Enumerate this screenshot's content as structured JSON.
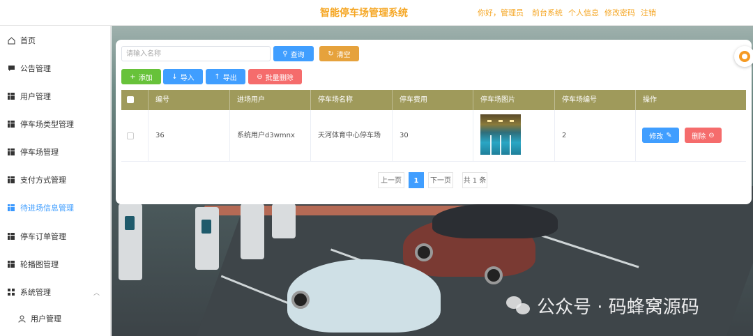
{
  "header": {
    "title": "智能停车场管理系统",
    "greeting": "你好，管理员",
    "links": [
      "前台系统",
      "个人信息",
      "修改密码",
      "注销"
    ]
  },
  "sidebar": {
    "items": [
      {
        "label": "首页",
        "icon": "home-icon"
      },
      {
        "label": "公告管理",
        "icon": "message-icon"
      },
      {
        "label": "用户管理",
        "icon": "grid-icon"
      },
      {
        "label": "停车场类型管理",
        "icon": "grid-icon"
      },
      {
        "label": "停车场管理",
        "icon": "grid-icon"
      },
      {
        "label": "支付方式管理",
        "icon": "grid-icon"
      },
      {
        "label": "待进场信息管理",
        "icon": "grid-icon",
        "active": true
      },
      {
        "label": "停车订单管理",
        "icon": "grid-icon"
      },
      {
        "label": "轮播图管理",
        "icon": "grid-icon"
      },
      {
        "label": "系统管理",
        "icon": "grid-icon",
        "expanded": true
      },
      {
        "label": "用户管理",
        "icon": "user-icon",
        "sub": true
      }
    ]
  },
  "toolbar": {
    "search_placeholder": "请输入名称",
    "search_label": "查询",
    "reset_label": "清空",
    "add_label": "添加",
    "import_label": "导入",
    "export_label": "导出",
    "batch_delete_label": "批量删除"
  },
  "table": {
    "columns": [
      "编号",
      "进场用户",
      "停车场名称",
      "停车费用",
      "停车场图片",
      "停车场编号",
      "操作"
    ],
    "rows": [
      {
        "id": "36",
        "user": "系统用户d3wmnx",
        "lot_name": "天河体育中心停车场",
        "fee": "30",
        "lot_no": "2",
        "edit_label": "修改",
        "delete_label": "删除"
      }
    ]
  },
  "pagination": {
    "prev": "上一页",
    "current": "1",
    "next": "下一页",
    "total": "共 1 条"
  },
  "watermark": "公众号 · 码蜂窝源码",
  "colors": {
    "accent": "#f5a623",
    "primary": "#409eff",
    "table_header": "#9f9a5b",
    "add": "#67c23a",
    "reset": "#e6a23c",
    "danger": "#f56c6c"
  }
}
